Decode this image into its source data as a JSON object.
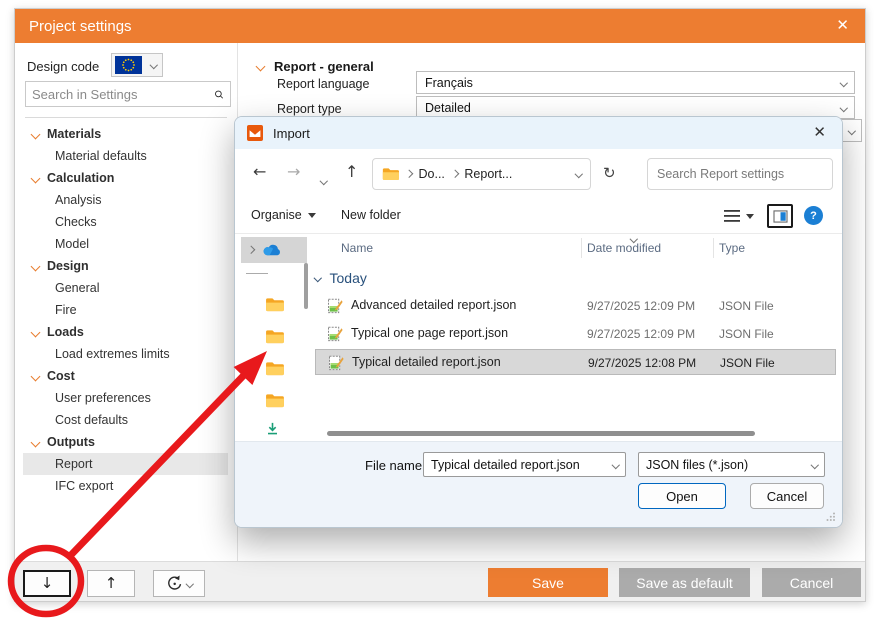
{
  "window": {
    "title": "Project settings"
  },
  "icons": {
    "close_glyph": "✕",
    "back_glyph": "←",
    "forward_glyph": "→",
    "up_glyph": "↑",
    "down_glyph": "↓",
    "refresh_glyph": "↻",
    "help_glyph": "?"
  },
  "design_code": {
    "label": "Design code",
    "flag": "eu-flag"
  },
  "search": {
    "placeholder": "Search in Settings"
  },
  "sidebar": {
    "tree": [
      {
        "label": "Materials",
        "type": "category"
      },
      {
        "label": "Material defaults",
        "type": "item"
      },
      {
        "label": "Calculation",
        "type": "category"
      },
      {
        "label": "Analysis",
        "type": "item"
      },
      {
        "label": "Checks",
        "type": "item"
      },
      {
        "label": "Model",
        "type": "item"
      },
      {
        "label": "Design",
        "type": "category"
      },
      {
        "label": "General",
        "type": "item"
      },
      {
        "label": "Fire",
        "type": "item"
      },
      {
        "label": "Loads",
        "type": "category"
      },
      {
        "label": "Load extremes limits",
        "type": "item"
      },
      {
        "label": "Cost",
        "type": "category"
      },
      {
        "label": "User preferences",
        "type": "item"
      },
      {
        "label": "Cost defaults",
        "type": "item"
      },
      {
        "label": "Outputs",
        "type": "category"
      },
      {
        "label": "Report",
        "type": "item",
        "selected": true
      },
      {
        "label": "IFC export",
        "type": "item"
      }
    ]
  },
  "report_section": {
    "title": "Report - general",
    "rows": [
      {
        "label": "Report language",
        "value": "Français"
      },
      {
        "label": "Report type",
        "value": "Detailed"
      }
    ]
  },
  "import_dialog": {
    "title": "Import",
    "breadcrumb": [
      "Do...",
      "Report..."
    ],
    "search_placeholder": "Search Report settings",
    "toolbar": {
      "organise": "Organise",
      "new_folder": "New folder"
    },
    "columns": [
      "Name",
      "Date modified",
      "Type"
    ],
    "group": "Today",
    "files": [
      {
        "name": "Advanced detailed report.json",
        "date": "9/27/2025 12:09 PM",
        "type": "JSON File",
        "selected": false
      },
      {
        "name": "Typical one page report.json",
        "date": "9/27/2025 12:09 PM",
        "type": "JSON File",
        "selected": false
      },
      {
        "name": "Typical detailed report.json",
        "date": "9/27/2025 12:08 PM",
        "type": "JSON File",
        "selected": true
      }
    ],
    "file_name_label": "File name:",
    "file_name_value": "Typical detailed report.json",
    "file_type_value": "JSON files (*.json)",
    "open_label": "Open",
    "cancel_label": "Cancel"
  },
  "footer_buttons": {
    "save": "Save",
    "save_as_default": "Save as default",
    "cancel": "Cancel"
  },
  "colors": {
    "accent_orange": "#ED7D31",
    "annotation_red": "#E8191C",
    "help_blue": "#1B7FD4",
    "folder_yellow": "#FFB900",
    "import_titlebar": "#E9F3FB",
    "selected_row": "#D8D8D8",
    "gray_button": "#ABABAB"
  }
}
